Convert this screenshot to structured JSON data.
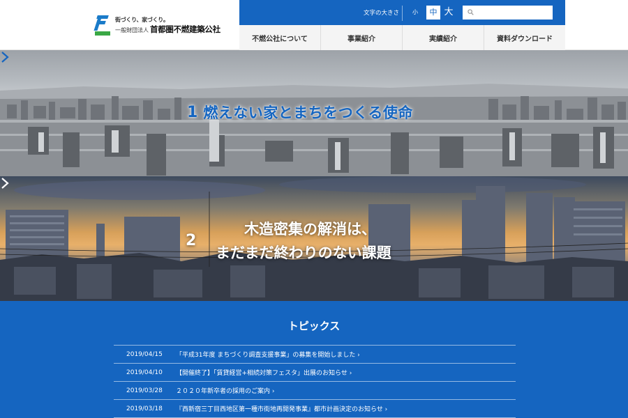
{
  "header": {
    "tagline": "街づくり、家づくり。",
    "org_prefix": "一般財団法人",
    "org_name": "首都圏不燃建築公社"
  },
  "utility": {
    "font_size_label": "文字の大きさ",
    "font_small": "小",
    "font_medium": "中",
    "font_large": "大",
    "search_placeholder": ""
  },
  "nav": {
    "items": [
      {
        "label": "不燃公社について"
      },
      {
        "label": "事業紹介"
      },
      {
        "label": "実績紹介"
      },
      {
        "label": "資料ダウンロード"
      }
    ]
  },
  "hero": [
    {
      "number": "1",
      "title": "燃えない家とまちをつくる使命"
    },
    {
      "number": "2",
      "line1": "木造密集の解消は、",
      "line2": "まだまだ終わりのない課題"
    }
  ],
  "topics": {
    "title": "トピックス",
    "items": [
      {
        "date": "2019/04/15",
        "title": "「平成31年度 まちづくり調査支援事業」の募集を開始しました ›"
      },
      {
        "date": "2019/04/10",
        "title": "【開催終了】「賃貸経営+相続対策フェスタ」出展のお知らせ ›"
      },
      {
        "date": "2019/03/28",
        "title": "２０２０年新卒者の採用のご案内 ›"
      },
      {
        "date": "2019/03/18",
        "title": "『西新宿三丁目西地区第一種市街地再開発事業』都市計画決定のお知らせ ›"
      }
    ]
  },
  "colors": {
    "brand_blue": "#1565c0",
    "logo_green": "#3aa845",
    "nav_bg": "#f4f4f4"
  }
}
